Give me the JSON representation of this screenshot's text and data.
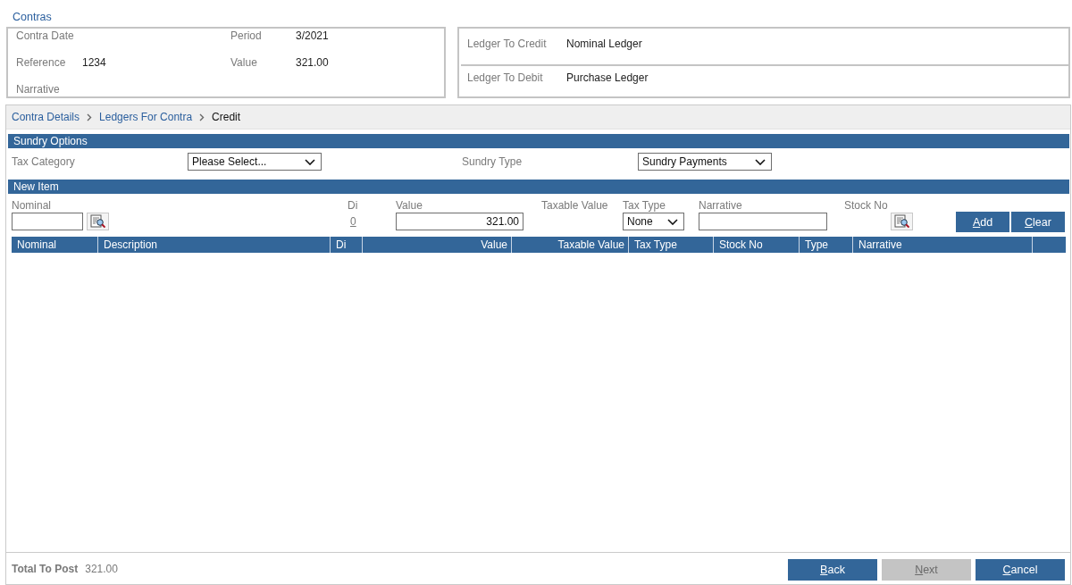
{
  "title": "Contras",
  "summary": [
    {
      "label": "Contra Date"
    },
    {
      "label": "Period",
      "value": "3/2021"
    },
    {
      "label": "Reference",
      "value": "1234"
    },
    {
      "label": "Value",
      "value": "321.00"
    },
    {
      "label": "Narrative"
    }
  ],
  "ledgers": [
    {
      "label": "Ledger To Credit",
      "value": "Nominal Ledger"
    },
    {
      "label": "Ledger To Debit",
      "value": "Purchase Ledger"
    }
  ],
  "breadcrumb": [
    {
      "label": "Contra Details",
      "current": false
    },
    {
      "label": "Ledgers For Contra",
      "current": false
    },
    {
      "label": "Credit",
      "current": true
    }
  ],
  "sundry_options": {
    "title": "Sundry Options",
    "fields": [
      {
        "label": "Tax Category",
        "value": "Please Select..."
      },
      {
        "label": "Sundry Type",
        "value": "Sundry Payments"
      }
    ]
  },
  "new_item": {
    "title": "New Item",
    "fields": [
      {
        "kind": "lookup-input",
        "label": "Nominal"
      },
      {
        "kind": "link",
        "label": "Di",
        "value": "0"
      },
      {
        "kind": "input",
        "label": "Value",
        "value": "321.00"
      },
      {
        "kind": "text",
        "label": "Taxable Value"
      },
      {
        "kind": "select",
        "label": "Tax Type",
        "value": "None"
      },
      {
        "kind": "input",
        "label": "Narrative"
      },
      {
        "kind": "lookup",
        "label": "Stock No"
      }
    ],
    "buttons": [
      {
        "label": "Add"
      },
      {
        "label": "Clear"
      }
    ]
  },
  "table": {
    "columns": [
      {
        "label": "Nominal"
      },
      {
        "label": "Description"
      },
      {
        "label": "Di"
      },
      {
        "label": "Value"
      },
      {
        "label": "Taxable Value"
      },
      {
        "label": "Tax Type"
      },
      {
        "label": "Stock No"
      },
      {
        "label": "Type"
      },
      {
        "label": "Narrative"
      }
    ]
  },
  "footer": {
    "total_label": "Total To Post",
    "total_value": "321.00",
    "buttons": [
      {
        "label": "Back",
        "disabled": false
      },
      {
        "label": "Next",
        "disabled": true
      },
      {
        "label": "Cancel",
        "disabled": false
      }
    ]
  }
}
